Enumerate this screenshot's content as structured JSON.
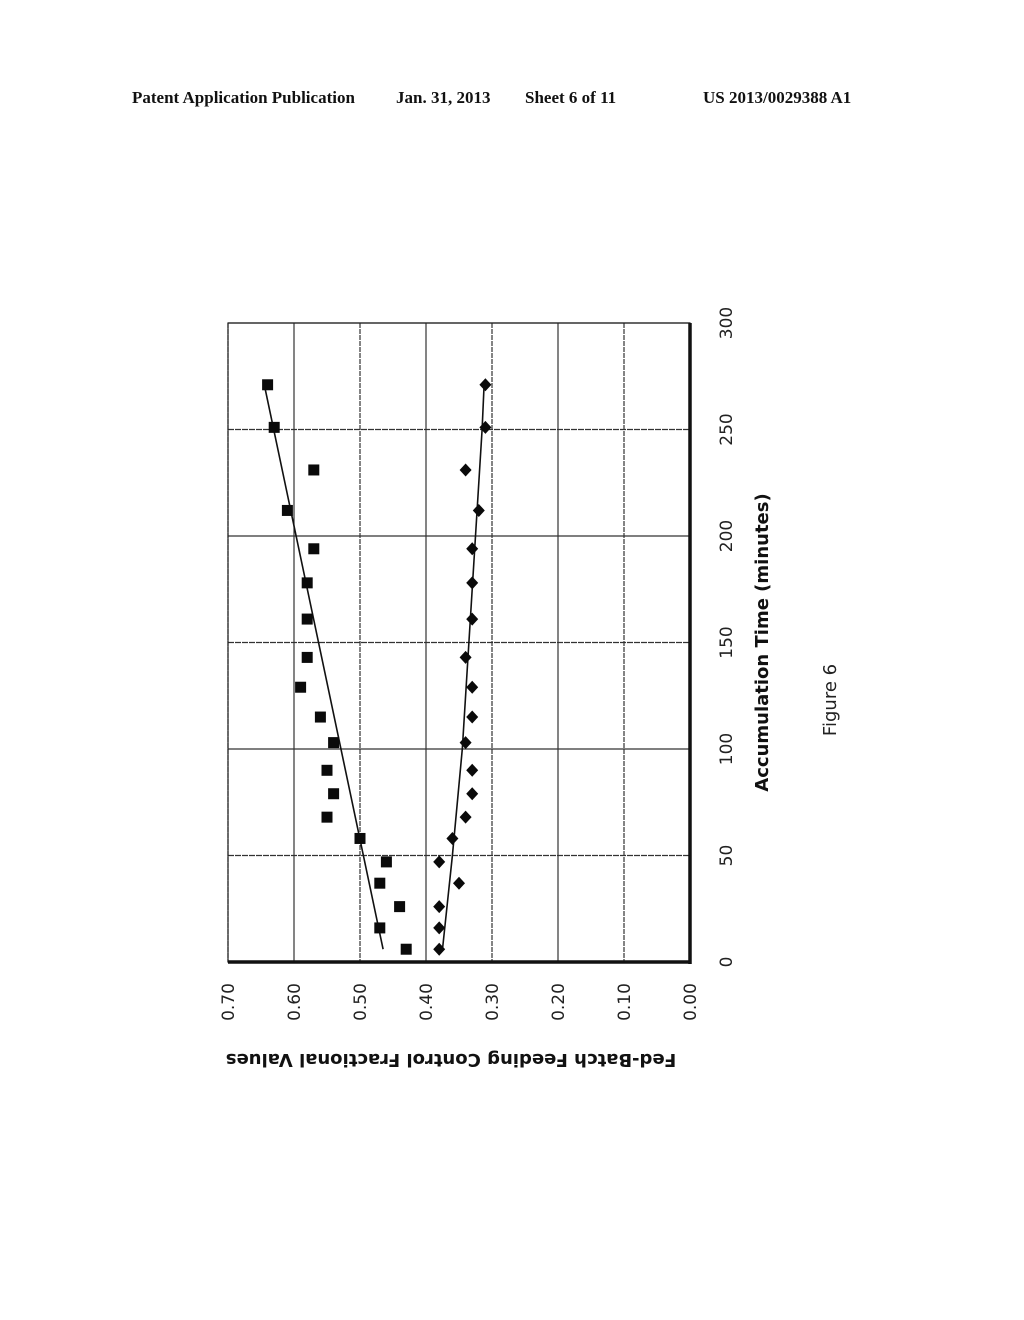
{
  "header": {
    "publication": "Patent Application Publication",
    "date": "Jan. 31, 2013",
    "sheet": "Sheet 6 of 11",
    "number": "US 2013/0029388 A1"
  },
  "figure_caption": "Figure 6",
  "chart_data": {
    "type": "scatter",
    "orientation": "rotated 90 degrees clockwise on page",
    "title": "",
    "xlabel": "Accumulation Time (minutes)",
    "ylabel": "Fed-Batch Feeding  Control Fractional Values",
    "xlim": [
      0,
      300
    ],
    "ylim": [
      0,
      0.7
    ],
    "x_ticks": [
      "0",
      "50",
      "100",
      "150",
      "200",
      "250",
      "300"
    ],
    "y_ticks": [
      "0.00",
      "0.10",
      "0.20",
      "0.30",
      "0.40",
      "0.50",
      "0.60",
      "0.70"
    ],
    "grid": true,
    "legend": "none",
    "series": [
      {
        "name": "Series 1 (squares)",
        "marker": "square",
        "x": [
          6,
          16,
          26,
          37,
          47,
          58,
          68,
          79,
          90,
          103,
          115,
          129,
          143,
          161,
          178,
          194,
          212,
          231,
          251,
          271
        ],
        "y": [
          0.43,
          0.47,
          0.44,
          0.47,
          0.46,
          0.5,
          0.55,
          0.54,
          0.55,
          0.54,
          0.56,
          0.59,
          0.58,
          0.58,
          0.58,
          0.57,
          0.61,
          0.57,
          0.63,
          0.64
        ],
        "trendline": {
          "type": "linear",
          "x": [
            6,
            271
          ],
          "y": [
            0.465,
            0.645
          ]
        }
      },
      {
        "name": "Series 2 (diamonds)",
        "marker": "diamond",
        "x": [
          6,
          16,
          26,
          37,
          47,
          58,
          68,
          79,
          90,
          103,
          115,
          129,
          143,
          161,
          178,
          194,
          212,
          231,
          251,
          271
        ],
        "y": [
          0.38,
          0.38,
          0.38,
          0.35,
          0.38,
          0.36,
          0.34,
          0.33,
          0.33,
          0.34,
          0.33,
          0.33,
          0.34,
          0.33,
          0.33,
          0.33,
          0.32,
          0.34,
          0.31,
          0.31
        ],
        "trendline": {
          "type": "polynomial",
          "x": [
            6,
            50,
            100,
            150,
            200,
            250,
            271
          ],
          "y": [
            0.375,
            0.36,
            0.345,
            0.335,
            0.325,
            0.315,
            0.312
          ]
        }
      }
    ]
  }
}
